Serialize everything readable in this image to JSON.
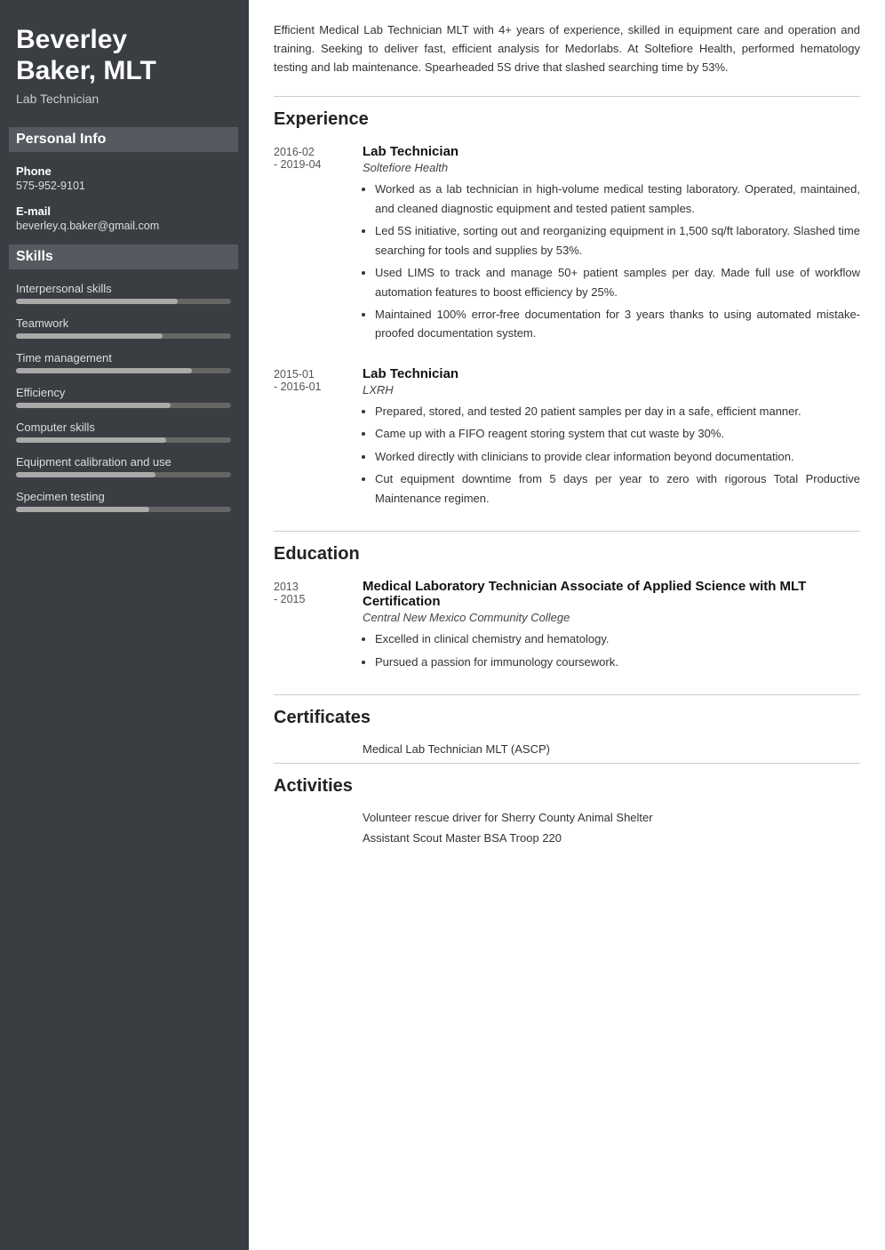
{
  "sidebar": {
    "name": "Beverley Baker, MLT",
    "name_line1": "Beverley",
    "name_line2": "Baker, MLT",
    "title": "Lab Technician",
    "personal_info_heading": "Personal Info",
    "phone_label": "Phone",
    "phone_value": "575-952-9101",
    "email_label": "E-mail",
    "email_value": "beverley.q.baker@gmail.com",
    "skills_heading": "Skills",
    "skills": [
      {
        "name": "Interpersonal skills",
        "percent": 75
      },
      {
        "name": "Teamwork",
        "percent": 68
      },
      {
        "name": "Time management",
        "percent": 82
      },
      {
        "name": "Efficiency",
        "percent": 72
      },
      {
        "name": "Computer skills",
        "percent": 70
      },
      {
        "name": "Equipment calibration and use",
        "percent": 65
      },
      {
        "name": "Specimen testing",
        "percent": 62
      }
    ]
  },
  "main": {
    "summary": "Efficient Medical Lab Technician MLT with 4+ years of experience, skilled in equipment care and operation and training. Seeking to deliver fast, efficient analysis for Medorlabs. At Soltefiore Health, performed hematology testing and lab maintenance. Spearheaded 5S drive that slashed searching time by 53%.",
    "experience_heading": "Experience",
    "experience": [
      {
        "date": "2016-02 - 2019-04",
        "job_title": "Lab Technician",
        "company": "Soltefiore Health",
        "bullets": [
          "Worked as a lab technician in high-volume medical testing laboratory. Operated, maintained, and cleaned diagnostic equipment and tested patient samples.",
          "Led 5S initiative, sorting out and reorganizing equipment in 1,500 sq/ft laboratory. Slashed time searching for tools and supplies by 53%.",
          "Used LIMS to track and manage 50+ patient samples per day. Made full use of workflow automation features to boost efficiency by 25%.",
          "Maintained 100% error-free documentation for 3 years thanks to using automated mistake-proofed documentation system."
        ]
      },
      {
        "date": "2015-01 - 2016-01",
        "job_title": "Lab Technician",
        "company": "LXRH",
        "bullets": [
          "Prepared, stored, and tested 20 patient samples per day in a safe, efficient manner.",
          "Came up with a FIFO reagent storing system that cut waste by 30%.",
          "Worked directly with clinicians to provide clear information beyond documentation.",
          "Cut equipment downtime from 5 days per year to zero with rigorous Total Productive Maintenance regimen."
        ]
      }
    ],
    "education_heading": "Education",
    "education": [
      {
        "date": "2013 - 2015",
        "degree": "Medical Laboratory Technician Associate of Applied Science with MLT Certification",
        "institution": "Central New Mexico Community College",
        "bullets": [
          "Excelled in clinical chemistry and hematology.",
          "Pursued a passion for immunology coursework."
        ]
      }
    ],
    "certificates_heading": "Certificates",
    "certificates": [
      "Medical Lab Technician MLT (ASCP)"
    ],
    "activities_heading": "Activities",
    "activities": [
      "Volunteer rescue driver for Sherry County Animal Shelter",
      "Assistant Scout Master BSA Troop 220"
    ]
  }
}
